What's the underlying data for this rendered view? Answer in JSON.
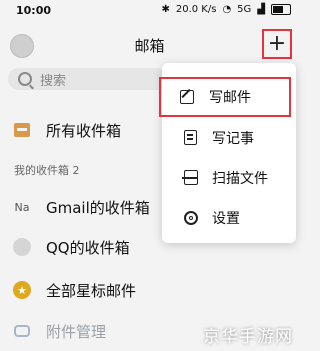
{
  "status_bar": {
    "time": "10:00",
    "network": "5G",
    "speed": "20.0 K/s"
  },
  "header": {
    "title": "邮箱",
    "add_label": "+"
  },
  "search": {
    "placeholder": "搜索"
  },
  "folders": {
    "all_inbox": "所有收件箱",
    "my_inboxes_label": "我的收件箱 2",
    "accounts": [
      {
        "badge": "Na",
        "label": "Gmail的收件箱"
      },
      {
        "badge": "",
        "label": "QQ的收件箱"
      }
    ],
    "starred": "全部星标邮件",
    "attachments": "附件管理"
  },
  "menu": {
    "items": [
      {
        "icon": "compose-icon",
        "label": "写邮件"
      },
      {
        "icon": "note-icon",
        "label": "写记事"
      },
      {
        "icon": "scan-icon",
        "label": "扫描文件"
      },
      {
        "icon": "gear-icon",
        "label": "设置"
      }
    ]
  },
  "watermark": "京华手游网",
  "colors": {
    "highlight": "#e4343c",
    "inbox_icon": "#d89a4a",
    "star_icon": "#e0a81c"
  }
}
